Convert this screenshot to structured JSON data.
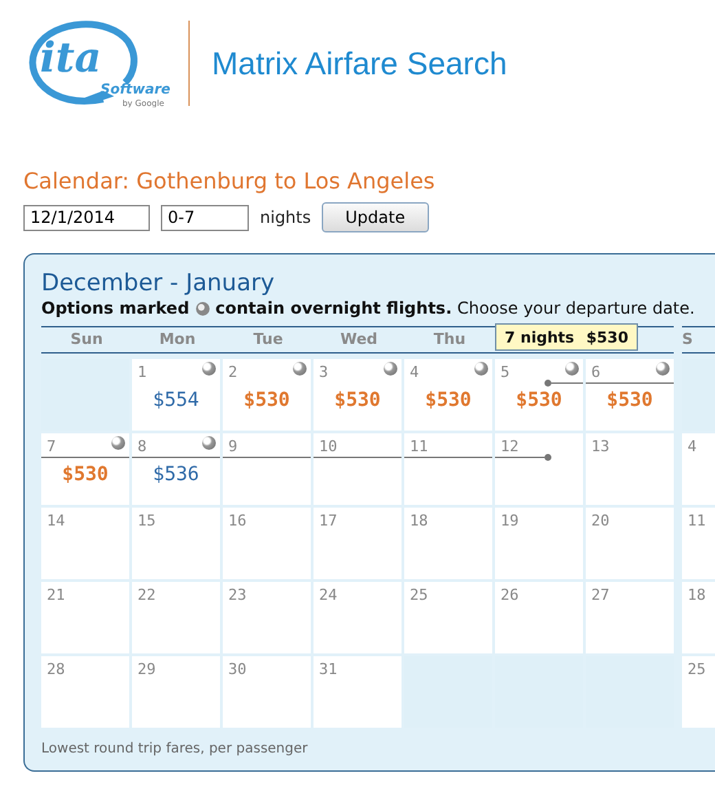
{
  "header": {
    "logo": {
      "mark": "ita",
      "word": "Software",
      "byline": "by Google"
    },
    "title": "Matrix Airfare Search"
  },
  "heading": "Calendar: Gothenburg to Los Angeles",
  "form": {
    "date": "12/1/2014",
    "nights": "0-7",
    "nights_label": "nights",
    "button": "Update"
  },
  "calendar": {
    "title": "December - January",
    "legend_lead": "Options marked",
    "legend_rest": "**contain overnight flights.** Choose your departure date.",
    "weekdays": [
      "Sun",
      "Mon",
      "Tue",
      "Wed",
      "Thu"
    ],
    "next_weekday": "S",
    "tooltip": {
      "nights": "7 nights",
      "price": "$530"
    },
    "weeks": [
      {
        "days": [
          {
            "kind": "blank"
          },
          {
            "kind": "day",
            "day": "1",
            "overnight": true,
            "price": "$554",
            "cheapest": false
          },
          {
            "kind": "day",
            "day": "2",
            "overnight": true,
            "price": "$530",
            "cheapest": true
          },
          {
            "kind": "day",
            "day": "3",
            "overnight": true,
            "price": "$530",
            "cheapest": true
          },
          {
            "kind": "day",
            "day": "4",
            "overnight": true,
            "price": "$530",
            "cheapest": true
          },
          {
            "kind": "day",
            "day": "5",
            "overnight": true,
            "price": "$530",
            "cheapest": true,
            "in_trip": true,
            "trip_start": true
          },
          {
            "kind": "day",
            "day": "6",
            "overnight": true,
            "price": "$530",
            "cheapest": true,
            "in_trip": true
          }
        ],
        "next": {
          "kind": "blank"
        }
      },
      {
        "days": [
          {
            "kind": "day",
            "day": "7",
            "overnight": true,
            "price": "$530",
            "cheapest": true,
            "in_trip": true
          },
          {
            "kind": "day",
            "day": "8",
            "overnight": true,
            "price": "$536",
            "cheapest": false,
            "in_trip": true
          },
          {
            "kind": "day",
            "day": "9",
            "in_trip": true
          },
          {
            "kind": "day",
            "day": "10",
            "in_trip": true
          },
          {
            "kind": "day",
            "day": "11",
            "in_trip": true
          },
          {
            "kind": "day",
            "day": "12",
            "in_trip": true,
            "trip_end": true
          },
          {
            "kind": "day",
            "day": "13"
          }
        ],
        "next": {
          "kind": "day",
          "day": "4"
        }
      },
      {
        "days": [
          {
            "kind": "day",
            "day": "14"
          },
          {
            "kind": "day",
            "day": "15"
          },
          {
            "kind": "day",
            "day": "16"
          },
          {
            "kind": "day",
            "day": "17"
          },
          {
            "kind": "day",
            "day": "18"
          },
          {
            "kind": "day",
            "day": "19"
          },
          {
            "kind": "day",
            "day": "20"
          }
        ],
        "next": {
          "kind": "day",
          "day": "11"
        }
      },
      {
        "days": [
          {
            "kind": "day",
            "day": "21"
          },
          {
            "kind": "day",
            "day": "22"
          },
          {
            "kind": "day",
            "day": "23"
          },
          {
            "kind": "day",
            "day": "24"
          },
          {
            "kind": "day",
            "day": "25"
          },
          {
            "kind": "day",
            "day": "26"
          },
          {
            "kind": "day",
            "day": "27"
          }
        ],
        "next": {
          "kind": "day",
          "day": "18"
        }
      },
      {
        "days": [
          {
            "kind": "day",
            "day": "28"
          },
          {
            "kind": "day",
            "day": "29"
          },
          {
            "kind": "day",
            "day": "30"
          },
          {
            "kind": "day",
            "day": "31"
          },
          {
            "kind": "blank"
          },
          {
            "kind": "blank"
          },
          {
            "kind": "blank"
          }
        ],
        "next": {
          "kind": "day",
          "day": "25"
        }
      }
    ],
    "footer": "Lowest round trip fares, per passenger"
  }
}
